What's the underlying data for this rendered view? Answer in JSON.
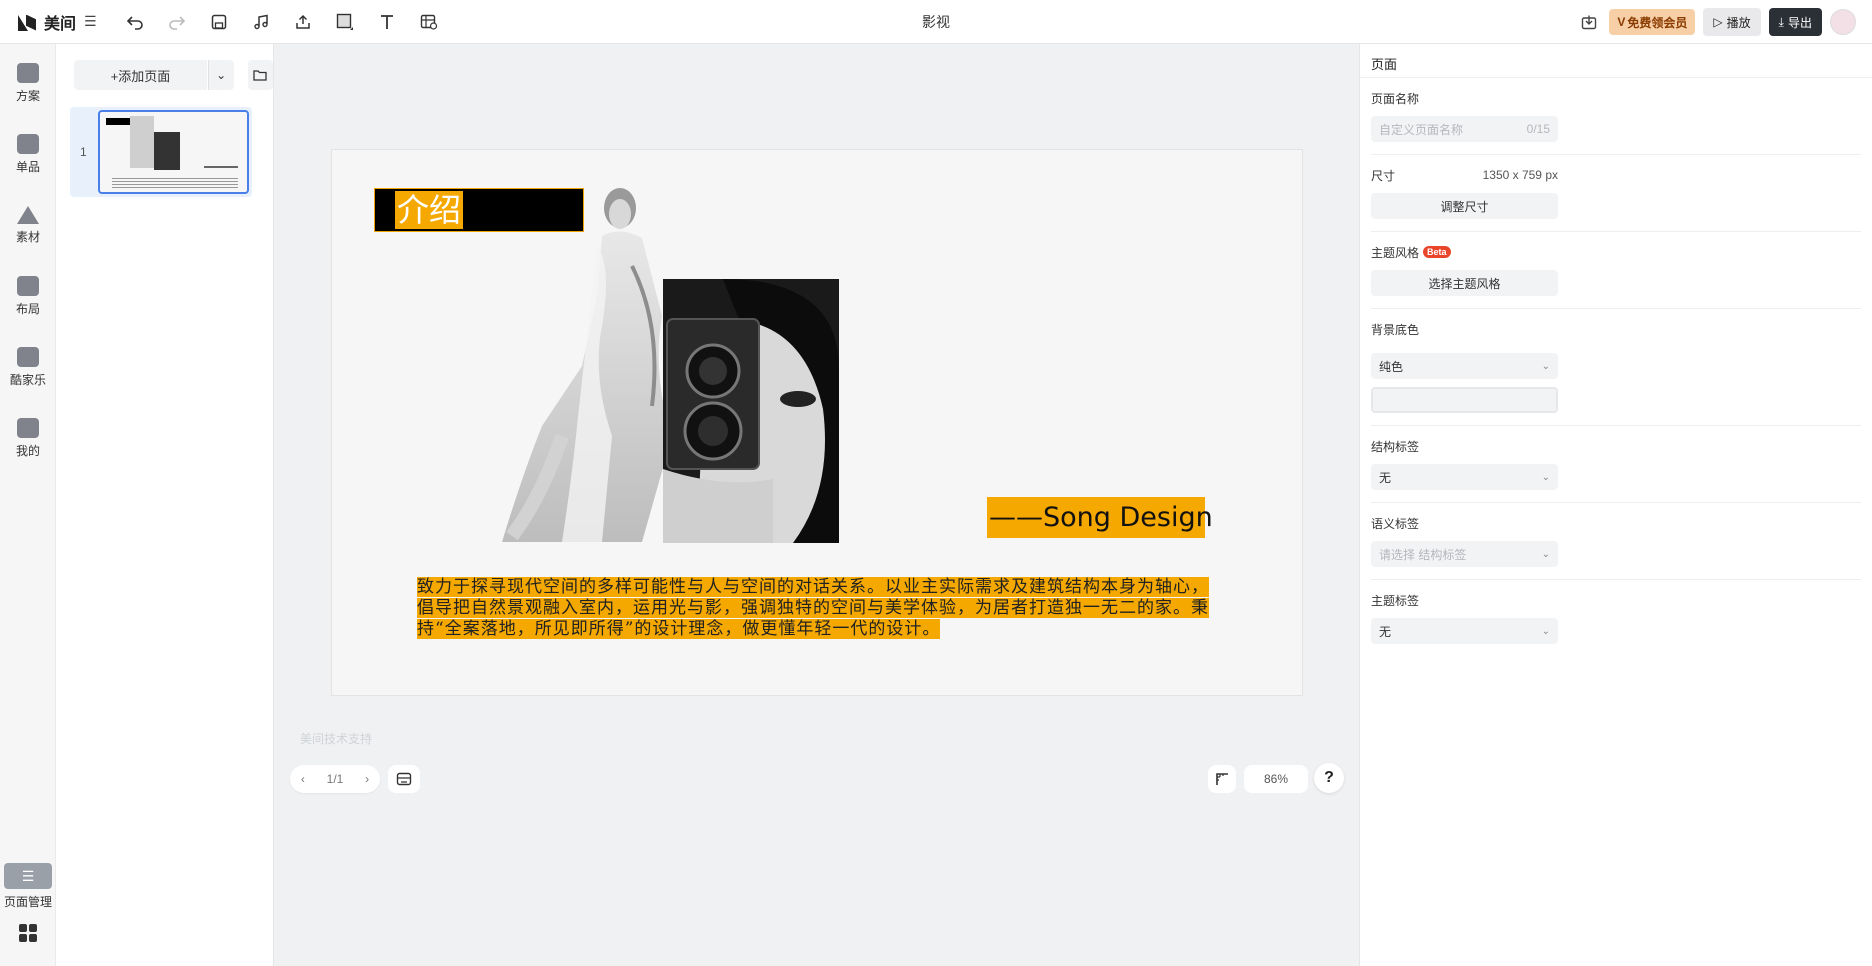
{
  "header": {
    "brand": "美间",
    "menu_glyph": "☰",
    "doc_title": "影视",
    "vip_label": "免费领会员",
    "play_label": "播放",
    "export_label": "导出"
  },
  "toolbar_icons": [
    "undo-icon",
    "redo-icon",
    "save-icon",
    "music-icon",
    "upload-icon",
    "shape-icon",
    "text-icon",
    "table-icon"
  ],
  "rail": {
    "items": [
      {
        "label": "方案",
        "icon": "plan-icon"
      },
      {
        "label": "单品",
        "icon": "product-icon"
      },
      {
        "label": "素材",
        "icon": "material-icon"
      },
      {
        "label": "布局",
        "icon": "layout-icon"
      },
      {
        "label": "酷家乐",
        "icon": "kujiale-icon"
      },
      {
        "label": "我的",
        "icon": "mine-icon"
      }
    ],
    "page_manager_label": "页面管理"
  },
  "pages_panel": {
    "add_page_label": "+添加页面",
    "pages": [
      {
        "number": "1"
      }
    ]
  },
  "slide": {
    "title": "介绍",
    "signature": "——Song Design",
    "body": "致力于探寻现代空间的多样可能性与人与空间的对话关系。以业主实际需求及建筑结构本身为轴心，倡导把自然景观融入室内，运用光与影，强调独特的空间与美学体验，为居者打造独一无二的家。秉持“全案落地，所见即所得”的设计理念，做更懂年轻一代的设计。",
    "accent_color": "#f5a800"
  },
  "canvas": {
    "watermark": "美间技术支持",
    "pager": "1/1",
    "zoom": "86%",
    "help": "?"
  },
  "props": {
    "heading": "页面",
    "page_name_label": "页面名称",
    "page_name_placeholder": "自定义页面名称",
    "page_name_count": "0/15",
    "size_label": "尺寸",
    "size_value": "1350 x 759 px",
    "resize_button": "调整尺寸",
    "theme_label": "主题风格",
    "beta_badge": "Beta",
    "theme_button": "选择主题风格",
    "bg_label": "背景底色",
    "bg_type": "纯色",
    "structure_label": "结构标签",
    "structure_value": "无",
    "semantic_label": "语义标签",
    "semantic_placeholder": "请选择 结构标签",
    "topic_label": "主题标签",
    "topic_value": "无"
  }
}
